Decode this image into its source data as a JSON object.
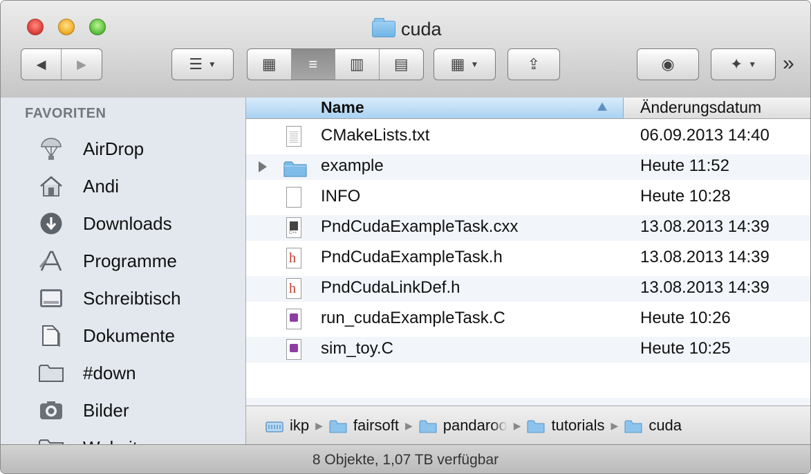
{
  "window": {
    "title": "cuda"
  },
  "toolbar": {
    "back_label": "◀",
    "forward_label": "▶",
    "arrange_glyph": "☰",
    "view_icons_glyph": "▦",
    "view_list_glyph": "≡",
    "view_columns_glyph": "▥",
    "view_coverflow_glyph": "▤",
    "action_glyph": "▦",
    "share_glyph": "⇪",
    "quicklook_glyph": "◉",
    "dropbox_glyph": "✦",
    "overflow_glyph": "»"
  },
  "sidebar": {
    "heading": "FAVORITEN",
    "items": [
      {
        "label": "AirDrop",
        "icon": "airdrop-icon"
      },
      {
        "label": "Andi",
        "icon": "home-icon"
      },
      {
        "label": "Downloads",
        "icon": "downloads-icon"
      },
      {
        "label": "Programme",
        "icon": "applications-icon"
      },
      {
        "label": "Schreibtisch",
        "icon": "desktop-icon"
      },
      {
        "label": "Dokumente",
        "icon": "documents-icon"
      },
      {
        "label": "#down",
        "icon": "folder-icon"
      },
      {
        "label": "Bilder",
        "icon": "pictures-icon"
      },
      {
        "label": "Websites",
        "icon": "folder-icon"
      }
    ]
  },
  "list": {
    "columns": {
      "name": "Name",
      "date": "Änderungsdatum"
    },
    "rows": [
      {
        "name": "CMakeLists.txt",
        "date": "06.09.2013 14:40",
        "kind": "text"
      },
      {
        "name": "example",
        "date": "Heute 11:52",
        "kind": "folder"
      },
      {
        "name": "INFO",
        "date": "Heute 10:28",
        "kind": "blank"
      },
      {
        "name": "PndCudaExampleTask.cxx",
        "date": "13.08.2013 14:39",
        "kind": "cxx"
      },
      {
        "name": "PndCudaExampleTask.h",
        "date": "13.08.2013 14:39",
        "kind": "h"
      },
      {
        "name": "PndCudaLinkDef.h",
        "date": "13.08.2013 14:39",
        "kind": "h"
      },
      {
        "name": "run_cudaExampleTask.C",
        "date": "Heute 10:26",
        "kind": "c"
      },
      {
        "name": "sim_toy.C",
        "date": "Heute 10:25",
        "kind": "c"
      }
    ]
  },
  "pathbar": {
    "items": [
      {
        "label": "ikp",
        "icon": "drive-icon"
      },
      {
        "label": "fairsoft",
        "icon": "folder-icon"
      },
      {
        "label": "pandaroo",
        "icon": "folder-icon"
      },
      {
        "label": "tutorials",
        "icon": "folder-icon"
      },
      {
        "label": "cuda",
        "icon": "folder-icon"
      }
    ]
  },
  "status": {
    "text": "8 Objekte, 1,07 TB verfügbar"
  },
  "colors": {
    "sidebar_bg": "#e3e8ee",
    "header_selected": "#a9d1f2",
    "alt_row": "#f2f5fa",
    "folder": "#6fb4e6",
    "close": "#e0443b",
    "minimize": "#f3b02d",
    "zoom": "#62c33f"
  }
}
